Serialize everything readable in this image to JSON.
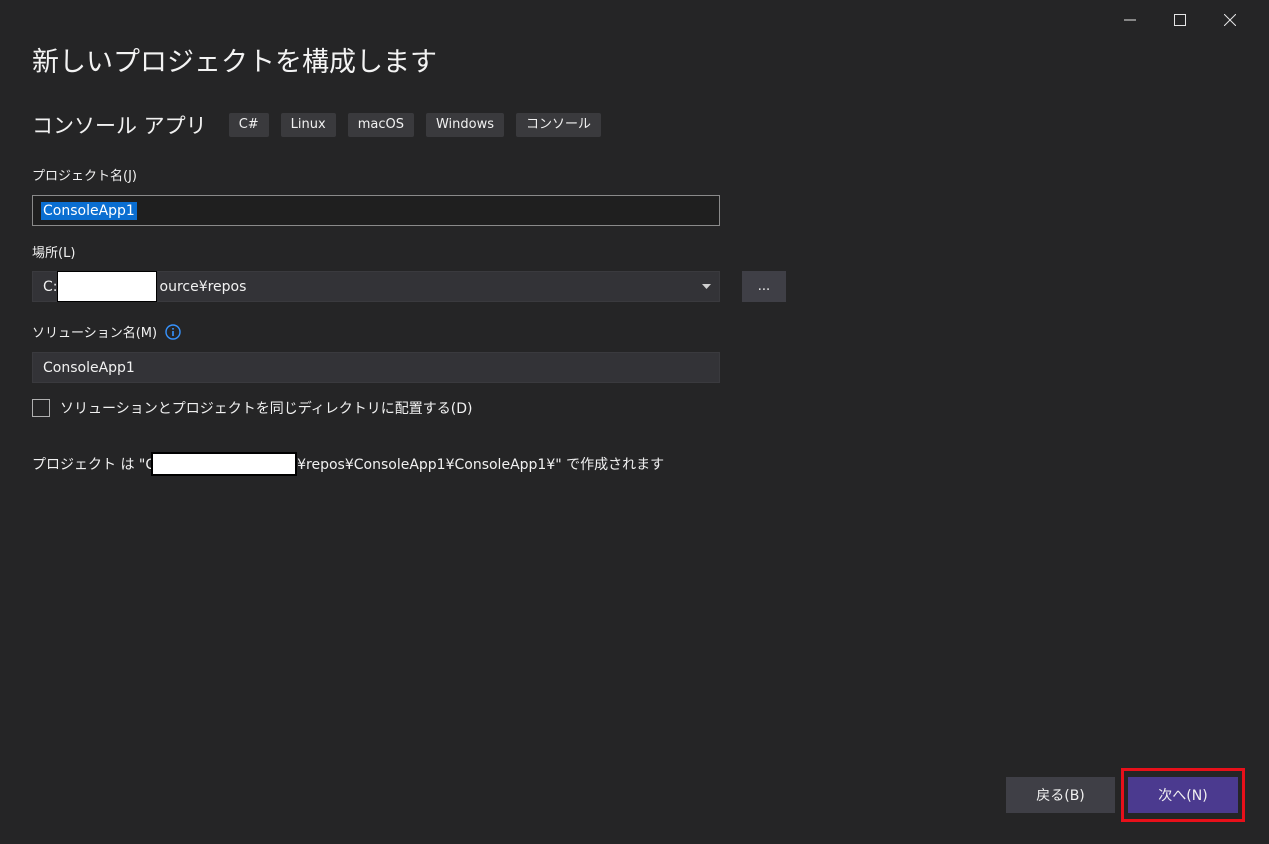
{
  "window": {
    "controls": [
      "minimize-icon",
      "maximize-icon",
      "close-icon"
    ]
  },
  "header": {
    "title": "新しいプロジェクトを構成します"
  },
  "template": {
    "name": "コンソール アプリ",
    "tags": [
      "C#",
      "Linux",
      "macOS",
      "Windows",
      "コンソール"
    ]
  },
  "form": {
    "project_name_label": "プロジェクト名(J)",
    "project_name_value": "ConsoleApp1",
    "location_label": "場所(L)",
    "location_prefix": "C:",
    "location_suffix": "ource¥repos",
    "browse_label": "...",
    "solution_name_label": "ソリューション名(M)",
    "solution_name_value": "ConsoleApp1",
    "same_dir_label": "ソリューションとプロジェクトを同じディレクトリに配置する(D)",
    "same_dir_checked": false,
    "path_prefix": "プロジェクト は \"C",
    "path_suffix": "¥repos¥ConsoleApp1¥ConsoleApp1¥\" で作成されます"
  },
  "footer": {
    "back_label": "戻る(B)",
    "next_label": "次へ(N)"
  },
  "colors": {
    "background": "#252526",
    "accent_button": "#4b3a8f",
    "highlight_box": "#e8101a",
    "selection": "#0a6ed1",
    "info_icon": "#3794ff"
  }
}
